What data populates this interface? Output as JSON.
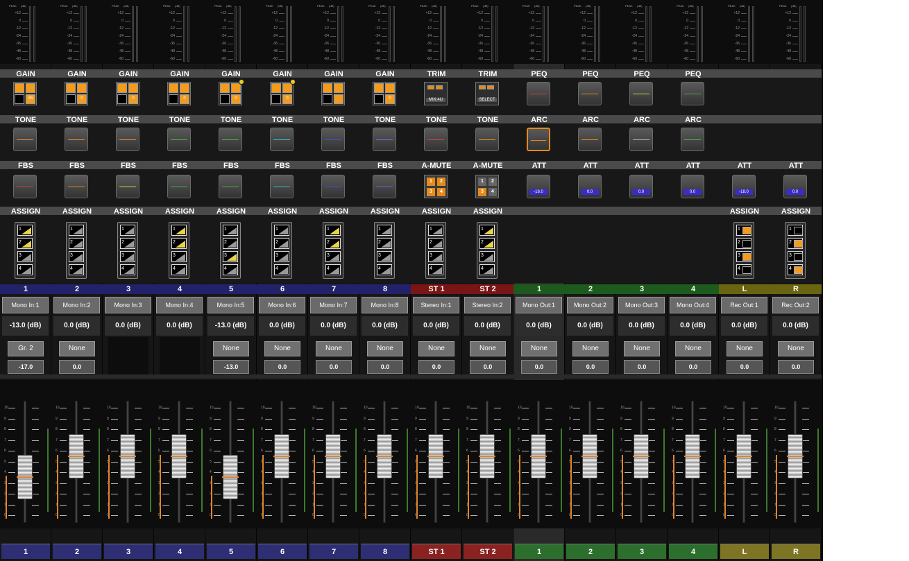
{
  "meter": {
    "peak_label": "PEAK",
    "unit_label": "(dB)",
    "scale": [
      "+12",
      "0",
      "-12",
      "-24",
      "-36",
      "-48",
      "-60"
    ]
  },
  "fader_scale": [
    "10",
    "9",
    "8",
    "7",
    "6",
    "5",
    "4",
    "3",
    "2",
    "1",
    "0"
  ],
  "colors": {
    "accent": "#e58a1c",
    "blue": "#22226a",
    "red": "#7a1515",
    "green": "#1d5a1d",
    "olive": "#6a6411",
    "att_value_bg": "#3a2cc9",
    "highlight_dot": "#e6d01e"
  },
  "strips": [
    {
      "num": "1",
      "name": "Mono In:1",
      "db": "-13.0 (dB)",
      "group": "Gr. 2",
      "pan": "-17.0",
      "color": "blue",
      "sec1": "GAIN",
      "sec2": "TONE",
      "sec3": "FBS",
      "sec4": "ASSIGN",
      "gain_value": "35",
      "tone_icon": "eq-curve-icon",
      "fbs_icon": "red-line-icon",
      "fader_level": 0.48
    },
    {
      "num": "2",
      "name": "Mono In:2",
      "db": "0.0 (dB)",
      "group": "None",
      "pan": "0.0",
      "color": "blue",
      "sec1": "GAIN",
      "sec2": "TONE",
      "sec3": "FBS",
      "sec4": "ASSIGN",
      "gain_value": "0",
      "tone_icon": "eq-curve-icon",
      "fbs_icon": "orange-line-icon",
      "fader_level": 0.68
    },
    {
      "num": "3",
      "name": "Mono In:3",
      "db": "0.0 (dB)",
      "group": "",
      "pan": "",
      "color": "blue",
      "sec1": "GAIN",
      "sec2": "TONE",
      "sec3": "FBS",
      "sec4": "ASSIGN",
      "gain_value": "0",
      "tone_icon": "eq-curve-icon",
      "fbs_icon": "yellow-line-icon",
      "fader_level": 0.68
    },
    {
      "num": "4",
      "name": "Mono In:4",
      "db": "0.0 (dB)",
      "group": "",
      "pan": "",
      "color": "blue",
      "sec1": "GAIN",
      "sec2": "TONE",
      "sec3": "FBS",
      "sec4": "ASSIGN",
      "gain_value": "0",
      "tone_icon": "green-line-icon",
      "fbs_icon": "green-line-icon",
      "fader_level": 0.68
    },
    {
      "num": "5",
      "name": "Mono In:5",
      "db": "-13.0 (dB)",
      "group": "None",
      "pan": "-13.0",
      "color": "blue",
      "sec1": "GAIN",
      "sec2": "TONE",
      "sec3": "FBS",
      "sec4": "ASSIGN",
      "gain_value": "0",
      "tone_icon": "green-line-icon",
      "fbs_icon": "green-line-icon",
      "fader_level": 0.48
    },
    {
      "num": "6",
      "name": "Mono In:6",
      "db": "0.0 (dB)",
      "group": "None",
      "pan": "0.0",
      "color": "blue",
      "sec1": "GAIN",
      "sec2": "TONE",
      "sec3": "FBS",
      "sec4": "ASSIGN",
      "gain_value": "0",
      "tone_icon": "cyan-line-icon",
      "fbs_icon": "cyan-line-icon",
      "fader_level": 0.68
    },
    {
      "num": "7",
      "name": "Mono In:7",
      "db": "0.0 (dB)",
      "group": "None",
      "pan": "0.0",
      "color": "blue",
      "sec1": "GAIN",
      "sec2": "TONE",
      "sec3": "FBS",
      "sec4": "ASSIGN",
      "gain_value": "",
      "tone_icon": "blue-line-icon",
      "fbs_icon": "blue-line-icon",
      "fader_level": 0.68
    },
    {
      "num": "8",
      "name": "Mono In:8",
      "db": "0.0 (dB)",
      "group": "None",
      "pan": "0.0",
      "color": "blue",
      "sec1": "GAIN",
      "sec2": "TONE",
      "sec3": "FBS",
      "sec4": "ASSIGN",
      "gain_value": "0",
      "tone_icon": "purple-line-icon",
      "fbs_icon": "purple-line-icon",
      "fader_level": 0.68
    },
    {
      "num": "ST 1",
      "name": "Stereo In:1",
      "db": "0.0 (dB)",
      "group": "None",
      "pan": "0.0",
      "color": "red",
      "sec1": "TRIM",
      "sec2": "TONE",
      "sec3": "A-MUTE",
      "sec4": "ASSIGN",
      "trim_value": "MIX:4U",
      "tone_icon": "red-line-icon",
      "amute": [
        "1",
        "2",
        "3",
        "4"
      ],
      "fader_level": 0.68
    },
    {
      "num": "ST 2",
      "name": "Stereo In:2",
      "db": "0.0 (dB)",
      "group": "None",
      "pan": "0.0",
      "color": "red",
      "sec1": "TRIM",
      "sec2": "TONE",
      "sec3": "A-MUTE",
      "sec4": "ASSIGN",
      "trim_value": "SELECT",
      "tone_icon": "orange-line-icon",
      "amute": [
        "1",
        "2",
        "3",
        "4"
      ],
      "fader_level": 0.68
    },
    {
      "num": "1",
      "name": "Mono Out:1",
      "db": "0.0 (dB)",
      "group": "None",
      "pan": "0.0",
      "color": "green",
      "sec1": "PEQ",
      "sec2": "ARC",
      "sec3": "ATT",
      "sec4": "",
      "att_value": "-18.0",
      "fader_level": 0.68
    },
    {
      "num": "2",
      "name": "Mono Out:2",
      "db": "0.0 (dB)",
      "group": "None",
      "pan": "0.0",
      "color": "green",
      "sec1": "PEQ",
      "sec2": "ARC",
      "sec3": "ATT",
      "sec4": "",
      "att_value": "0.0",
      "fader_level": 0.68
    },
    {
      "num": "3",
      "name": "Mono Out:3",
      "db": "0.0 (dB)",
      "group": "None",
      "pan": "0.0",
      "color": "green",
      "sec1": "PEQ",
      "sec2": "ARC",
      "sec3": "ATT",
      "sec4": "",
      "att_value": "0.0",
      "fader_level": 0.68
    },
    {
      "num": "4",
      "name": "Mono Out:4",
      "db": "0.0 (dB)",
      "group": "None",
      "pan": "0.0",
      "color": "green",
      "sec1": "PEQ",
      "sec2": "ARC",
      "sec3": "ATT",
      "sec4": "",
      "att_value": "0.0",
      "fader_level": 0.68
    },
    {
      "num": "L",
      "name": "Rec Out:1",
      "db": "0.0 (dB)",
      "group": "None",
      "pan": "0.0",
      "color": "olive",
      "sec1": "",
      "sec2": "",
      "sec3": "ATT",
      "sec4": "ASSIGN",
      "att_value": "-18.0",
      "fader_level": 0.68
    },
    {
      "num": "R",
      "name": "Rec Out:2",
      "db": "0.0 (dB)",
      "group": "None",
      "pan": "0.0",
      "color": "olive",
      "sec1": "",
      "sec2": "",
      "sec3": "ATT",
      "sec4": "ASSIGN",
      "att_value": "0.0",
      "fader_level": 0.68
    }
  ]
}
